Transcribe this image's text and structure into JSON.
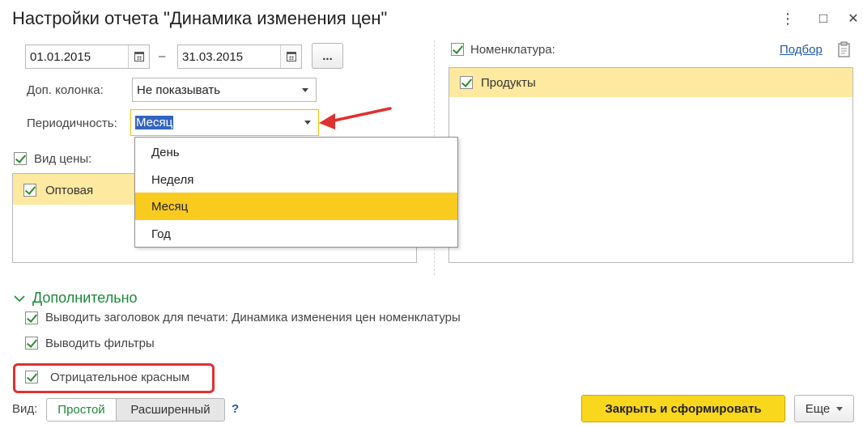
{
  "window": {
    "title": "Настройки отчета \"Динамика изменения цен\"",
    "menu_glyph": "⋮",
    "maximize_glyph": "□",
    "close_glyph": "✕"
  },
  "period": {
    "start": "01.01.2015",
    "dash": "–",
    "end": "31.03.2015",
    "more_button": "..."
  },
  "extra_column": {
    "label": "Доп. колонка:",
    "value": "Не показывать"
  },
  "periodicity": {
    "label": "Периодичность:",
    "value": "Месяц",
    "options": [
      "День",
      "Неделя",
      "Месяц",
      "Год"
    ],
    "selected_index": 2
  },
  "price_type": {
    "label": "Вид цены:",
    "items": [
      "Оптовая"
    ]
  },
  "nomenclature": {
    "label": "Номенклатура:",
    "pick_link": "Подбор",
    "items": [
      "Продукты"
    ]
  },
  "additional": {
    "header": "Дополнительно",
    "options": [
      "Выводить заголовок для печати: Динамика изменения цен номенклатуры",
      "Выводить фильтры",
      "Отрицательное красным"
    ]
  },
  "view_mode": {
    "label": "Вид:",
    "simple": "Простой",
    "extended": "Расширенный",
    "help": "?"
  },
  "footer": {
    "primary_button": "Закрыть и сформировать",
    "more_button": "Еще"
  },
  "colors": {
    "accent_yellow": "#f9cb1f",
    "selection_row": "#fde9a0",
    "annotation_red": "#e03030",
    "green": "#1a8a3a",
    "link_blue": "#1f57b0"
  }
}
